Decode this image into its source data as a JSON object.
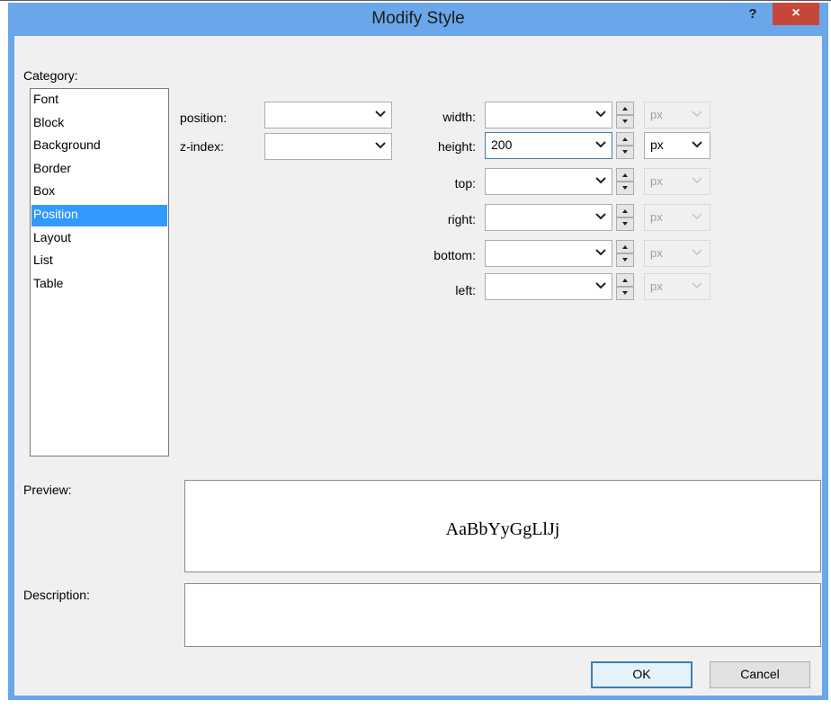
{
  "window": {
    "title": "Modify Style",
    "help_label": "?",
    "close_label": "×"
  },
  "category": {
    "label": "Category:",
    "items": [
      "Font",
      "Block",
      "Background",
      "Border",
      "Box",
      "Position",
      "Layout",
      "List",
      "Table"
    ],
    "selected": "Position"
  },
  "fields": {
    "position": {
      "label": "position:",
      "value": ""
    },
    "z_index": {
      "label": "z-index:",
      "value": ""
    },
    "width": {
      "label": "width:",
      "value": "",
      "unit": "px"
    },
    "height": {
      "label": "height:",
      "value": "200",
      "unit": "px"
    },
    "top": {
      "label": "top:",
      "value": "",
      "unit": "px"
    },
    "right": {
      "label": "right:",
      "value": "",
      "unit": "px"
    },
    "bottom": {
      "label": "bottom:",
      "value": "",
      "unit": "px"
    },
    "left": {
      "label": "left:",
      "value": "",
      "unit": "px"
    }
  },
  "preview": {
    "label": "Preview:",
    "sample_text": "AaBbYyGgLlJj"
  },
  "description": {
    "label": "Description:",
    "value": ""
  },
  "buttons": {
    "ok": "OK",
    "cancel": "Cancel"
  },
  "colors": {
    "title_bar": "#6aa7ea",
    "close_button": "#c7463a",
    "selection": "#3399ff"
  }
}
